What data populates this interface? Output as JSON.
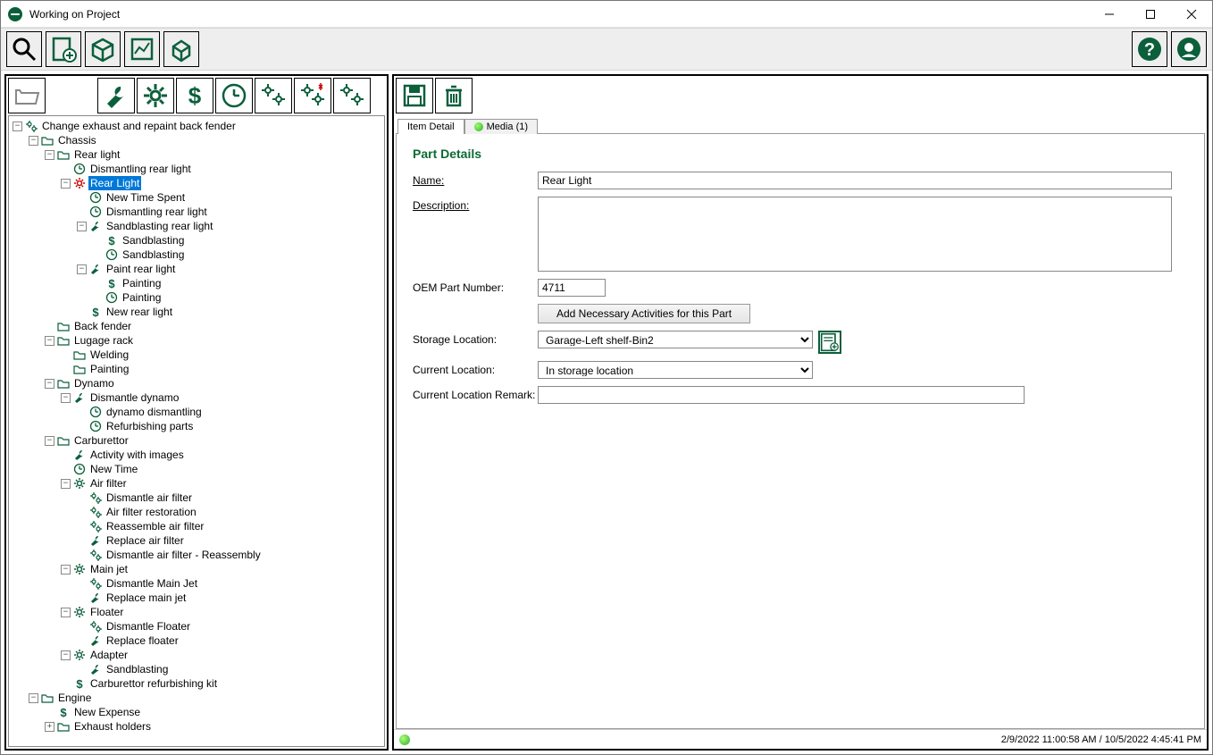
{
  "window": {
    "title": "Working on Project"
  },
  "tabs": {
    "item_detail": "Item Detail",
    "media": "Media (1)"
  },
  "part_details": {
    "heading": "Part Details",
    "labels": {
      "name": "Name:",
      "description": "Description:",
      "oem": "OEM Part Number:",
      "add_activities": "Add Necessary Activities for this Part",
      "storage": "Storage Location:",
      "current_loc": "Current Location:",
      "current_remark": "Current Location Remark:"
    },
    "values": {
      "name": "Rear Light",
      "description": "",
      "oem": "4711",
      "storage": "Garage-Left shelf-Bin2",
      "current_loc": "In storage location",
      "current_remark": ""
    }
  },
  "status": {
    "timestamps": "2/9/2022 11:00:58 AM / 10/5/2022 4:45:41 PM"
  },
  "tree": {
    "root": "Change exhaust and repaint back fender",
    "chassis": "Chassis",
    "rear_light_folder": "Rear light",
    "dismantling_rear_light": "Dismantling rear light",
    "rear_light_part": "Rear Light",
    "new_time_spent": "New Time Spent",
    "dismantling_rear_light2": "Dismantling rear light",
    "sandblasting_rear_light": "Sandblasting rear light",
    "sandblasting1": "Sandblasting",
    "sandblasting2": "Sandblasting",
    "paint_rear_light": "Paint rear light",
    "painting1": "Painting",
    "painting2": "Painting",
    "new_rear_light": "New rear light",
    "back_fender": "Back fender",
    "lugage_rack": "Lugage rack",
    "welding": "Welding",
    "painting_folder": "Painting",
    "dynamo": "Dynamo",
    "dismantle_dynamo": "Dismantle dynamo",
    "dynamo_dismantling": "dynamo dismantling",
    "refurbishing_parts": "Refurbishing parts",
    "carburettor": "Carburettor",
    "activity_with_images": "Activity with images",
    "new_time": "New Time",
    "air_filter": "Air filter",
    "dismantle_air_filter": "Dismantle air filter",
    "air_filter_restoration": "Air filter restoration",
    "reassemble_air_filter": "Reassemble air filter",
    "replace_air_filter": "Replace air filter",
    "dismantle_air_filter_reassembly": "Dismantle air filter - Reassembly",
    "main_jet": "Main jet",
    "dismantle_main_jet": "Dismantle Main Jet",
    "replace_main_jet": "Replace main jet",
    "floater": "Floater",
    "dismantle_floater": "Dismantle Floater",
    "replace_floater": "Replace floater",
    "adapter": "Adapter",
    "sandblasting_adapter": "Sandblasting",
    "carburettor_refurbishing_kit": "Carburettor refurbishing kit",
    "engine": "Engine",
    "new_expense": "New Expense",
    "exhaust_holders": "Exhaust holders"
  }
}
